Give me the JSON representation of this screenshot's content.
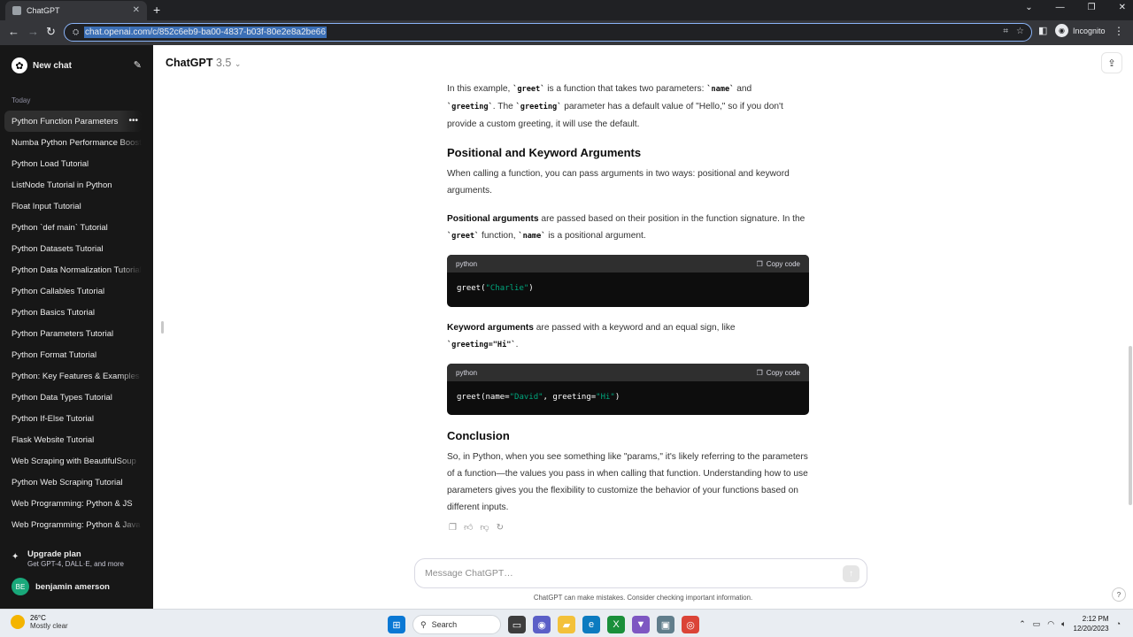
{
  "browser": {
    "tab_title": "ChatGPT",
    "url": "chat.openai.com/c/852c6eb9-ba00-4837-b03f-80e2e8a2be66",
    "profile": "Incognito"
  },
  "sidebar": {
    "new_chat": "New chat",
    "section": "Today",
    "items": [
      {
        "label": "Python Function Parameters"
      },
      {
        "label": "Numba Python Performance Boost"
      },
      {
        "label": "Python Load Tutorial"
      },
      {
        "label": "ListNode Tutorial in Python"
      },
      {
        "label": "Float Input Tutorial"
      },
      {
        "label": "Python `def main` Tutorial"
      },
      {
        "label": "Python Datasets Tutorial"
      },
      {
        "label": "Python Data Normalization Tutorial"
      },
      {
        "label": "Python Callables Tutorial"
      },
      {
        "label": "Python Basics Tutorial"
      },
      {
        "label": "Python Parameters Tutorial"
      },
      {
        "label": "Python Format Tutorial"
      },
      {
        "label": "Python: Key Features & Examples"
      },
      {
        "label": "Python Data Types Tutorial"
      },
      {
        "label": "Python If-Else Tutorial"
      },
      {
        "label": "Flask Website Tutorial"
      },
      {
        "label": "Web Scraping with BeautifulSoup"
      },
      {
        "label": "Python Web Scraping Tutorial"
      },
      {
        "label": "Web Programming: Python & JS"
      },
      {
        "label": "Web Programming: Python & Java"
      }
    ],
    "upgrade_title": "Upgrade plan",
    "upgrade_sub": "Get GPT-4, DALL·E, and more",
    "user_initials": "BE",
    "user_name": "benjamin amerson"
  },
  "header": {
    "model": "ChatGPT",
    "version": "3.5"
  },
  "content": {
    "p1_a": "In this example, ",
    "p1_code1": "`greet`",
    "p1_b": " is a function that takes two parameters: ",
    "p1_code2": "`name`",
    "p1_c": " and ",
    "p1_code3": "`greeting`",
    "p1_d": ". The ",
    "p1_code4": "`greeting`",
    "p1_e": " parameter has a default value of \"Hello,\" so if you don't provide a custom greeting, it will use the default.",
    "h_positional": "Positional and Keyword Arguments",
    "p2": "When calling a function, you can pass arguments in two ways: positional and keyword arguments.",
    "p3_bold": "Positional arguments",
    "p3_a": " are passed based on their position in the function signature. In the ",
    "p3_code1": "`greet`",
    "p3_b": " function, ",
    "p3_code2": "`name`",
    "p3_c": " is a positional argument.",
    "code1_lang": "python",
    "copy_label": "Copy code",
    "code1_fn": "greet(",
    "code1_str": "\"Charlie\"",
    "code1_end": ")",
    "p4_bold": "Keyword arguments",
    "p4_a": " are passed with a keyword and an equal sign, like ",
    "p4_code": "`greeting=\"Hi\"`",
    "p4_b": ".",
    "code2_lang": "python",
    "code2_a": "greet(name=",
    "code2_s1": "\"David\"",
    "code2_b": ", greeting=",
    "code2_s2": "\"Hi\"",
    "code2_end": ")",
    "h_conclusion": "Conclusion",
    "p5": "So, in Python, when you see something like \"params,\" it's likely referring to the parameters of a function—the values you pass in when calling that function. Understanding how to use parameters gives you the flexibility to customize the behavior of your functions based on different inputs."
  },
  "composer": {
    "placeholder": "Message ChatGPT…",
    "disclaimer": "ChatGPT can make mistakes. Consider checking important information."
  },
  "taskbar": {
    "temp": "26°C",
    "weather": "Mostly clear",
    "search": "Search",
    "time": "2:12 PM",
    "date": "12/20/2023"
  },
  "colors": {
    "sidebar_bg": "#171717",
    "code_string": "#00a67d",
    "avatar": "#19a87a"
  }
}
